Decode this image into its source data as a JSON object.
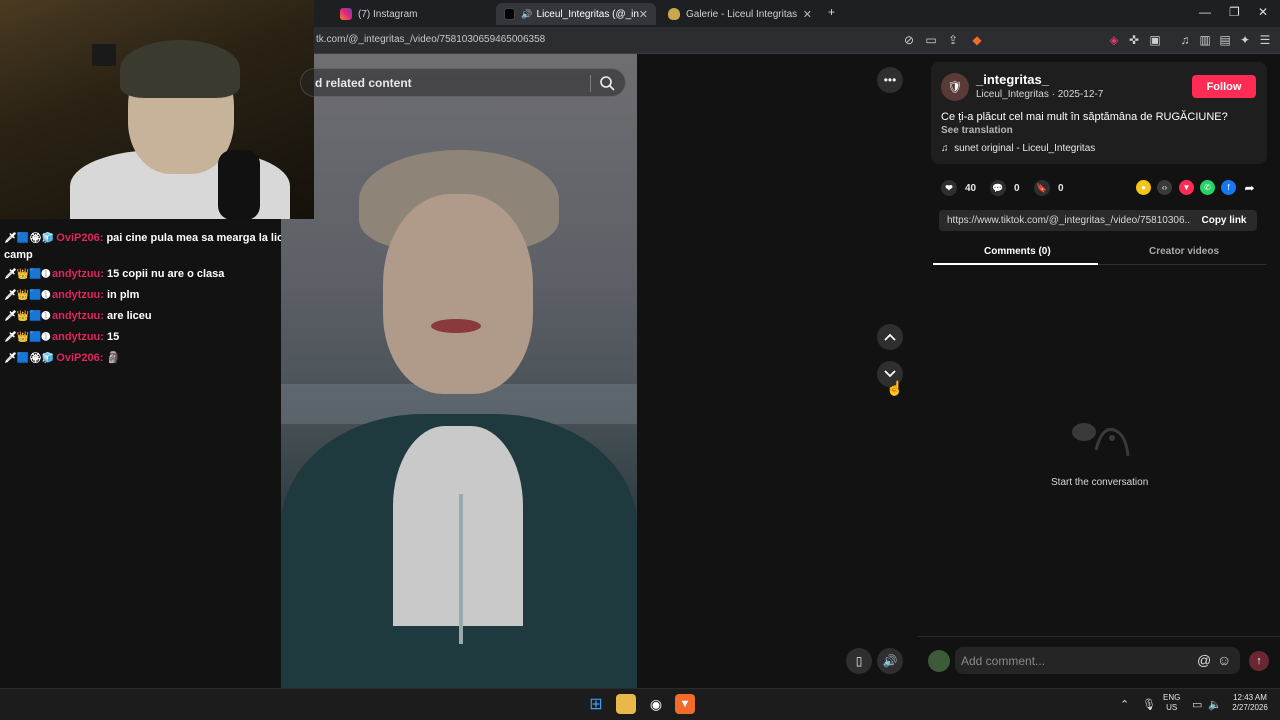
{
  "browser": {
    "tabs": [
      {
        "label": "(7) Instagram",
        "active": false
      },
      {
        "label": "Liceul_Integritas (@_integrita",
        "active": true
      },
      {
        "label": "Galerie - Liceul Integritas",
        "active": false
      }
    ],
    "new_tab_label": "+",
    "url": "tk.com/@_integritas_/video/7581030659465006358"
  },
  "chat": {
    "messages": [
      {
        "badges": "🗡🟦🏵🧊",
        "user": "OviP206:",
        "user_color": "#e0245e",
        "text": "pai cine pula mea sa mearga la liceu pe camp"
      },
      {
        "badges": "🗡👑🟦➊",
        "user": "andytzuu:",
        "user_color": "#e0245e",
        "text": "15 copii nu are o clasa"
      },
      {
        "badges": "🗡👑🟦➊",
        "user": "andytzuu:",
        "user_color": "#e0245e",
        "text": "in plm"
      },
      {
        "badges": "🗡👑🟦➊",
        "user": "andytzuu:",
        "user_color": "#e0245e",
        "text": "are liceu"
      },
      {
        "badges": "🗡👑🟦➊",
        "user": "andytzuu:",
        "user_color": "#e0245e",
        "text": "15"
      },
      {
        "badges": "🗡🟦🏵🧊",
        "user": "OviP206:",
        "user_color": "#e0245e",
        "text": "🗿"
      }
    ]
  },
  "video": {
    "search_text": "d related content"
  },
  "post": {
    "username": "_integritas_",
    "sub": "Liceul_Integritas · 2025-12-7",
    "follow_label": "Follow",
    "caption": "Ce ți-a plăcut cel mai mult în săptămâna de RUGĂCIUNE?",
    "see_translation": "See translation",
    "music_icon": "♫",
    "music": "sunet original - Liceul_Integritas",
    "likes": "40",
    "comments": "0",
    "saves": "0",
    "link": "https://www.tiktok.com/@_integritas_/video/75810306...",
    "copy_link_label": "Copy link",
    "tab_comments": "Comments (0)",
    "tab_creator": "Creator videos",
    "empty_text": "Start the conversation",
    "comment_placeholder": "Add comment...",
    "accent": "#fe2c55"
  },
  "taskbar": {
    "lang_top": "ENG",
    "lang_bottom": "US",
    "time": "12:43 AM",
    "date": "2/27/2026"
  }
}
